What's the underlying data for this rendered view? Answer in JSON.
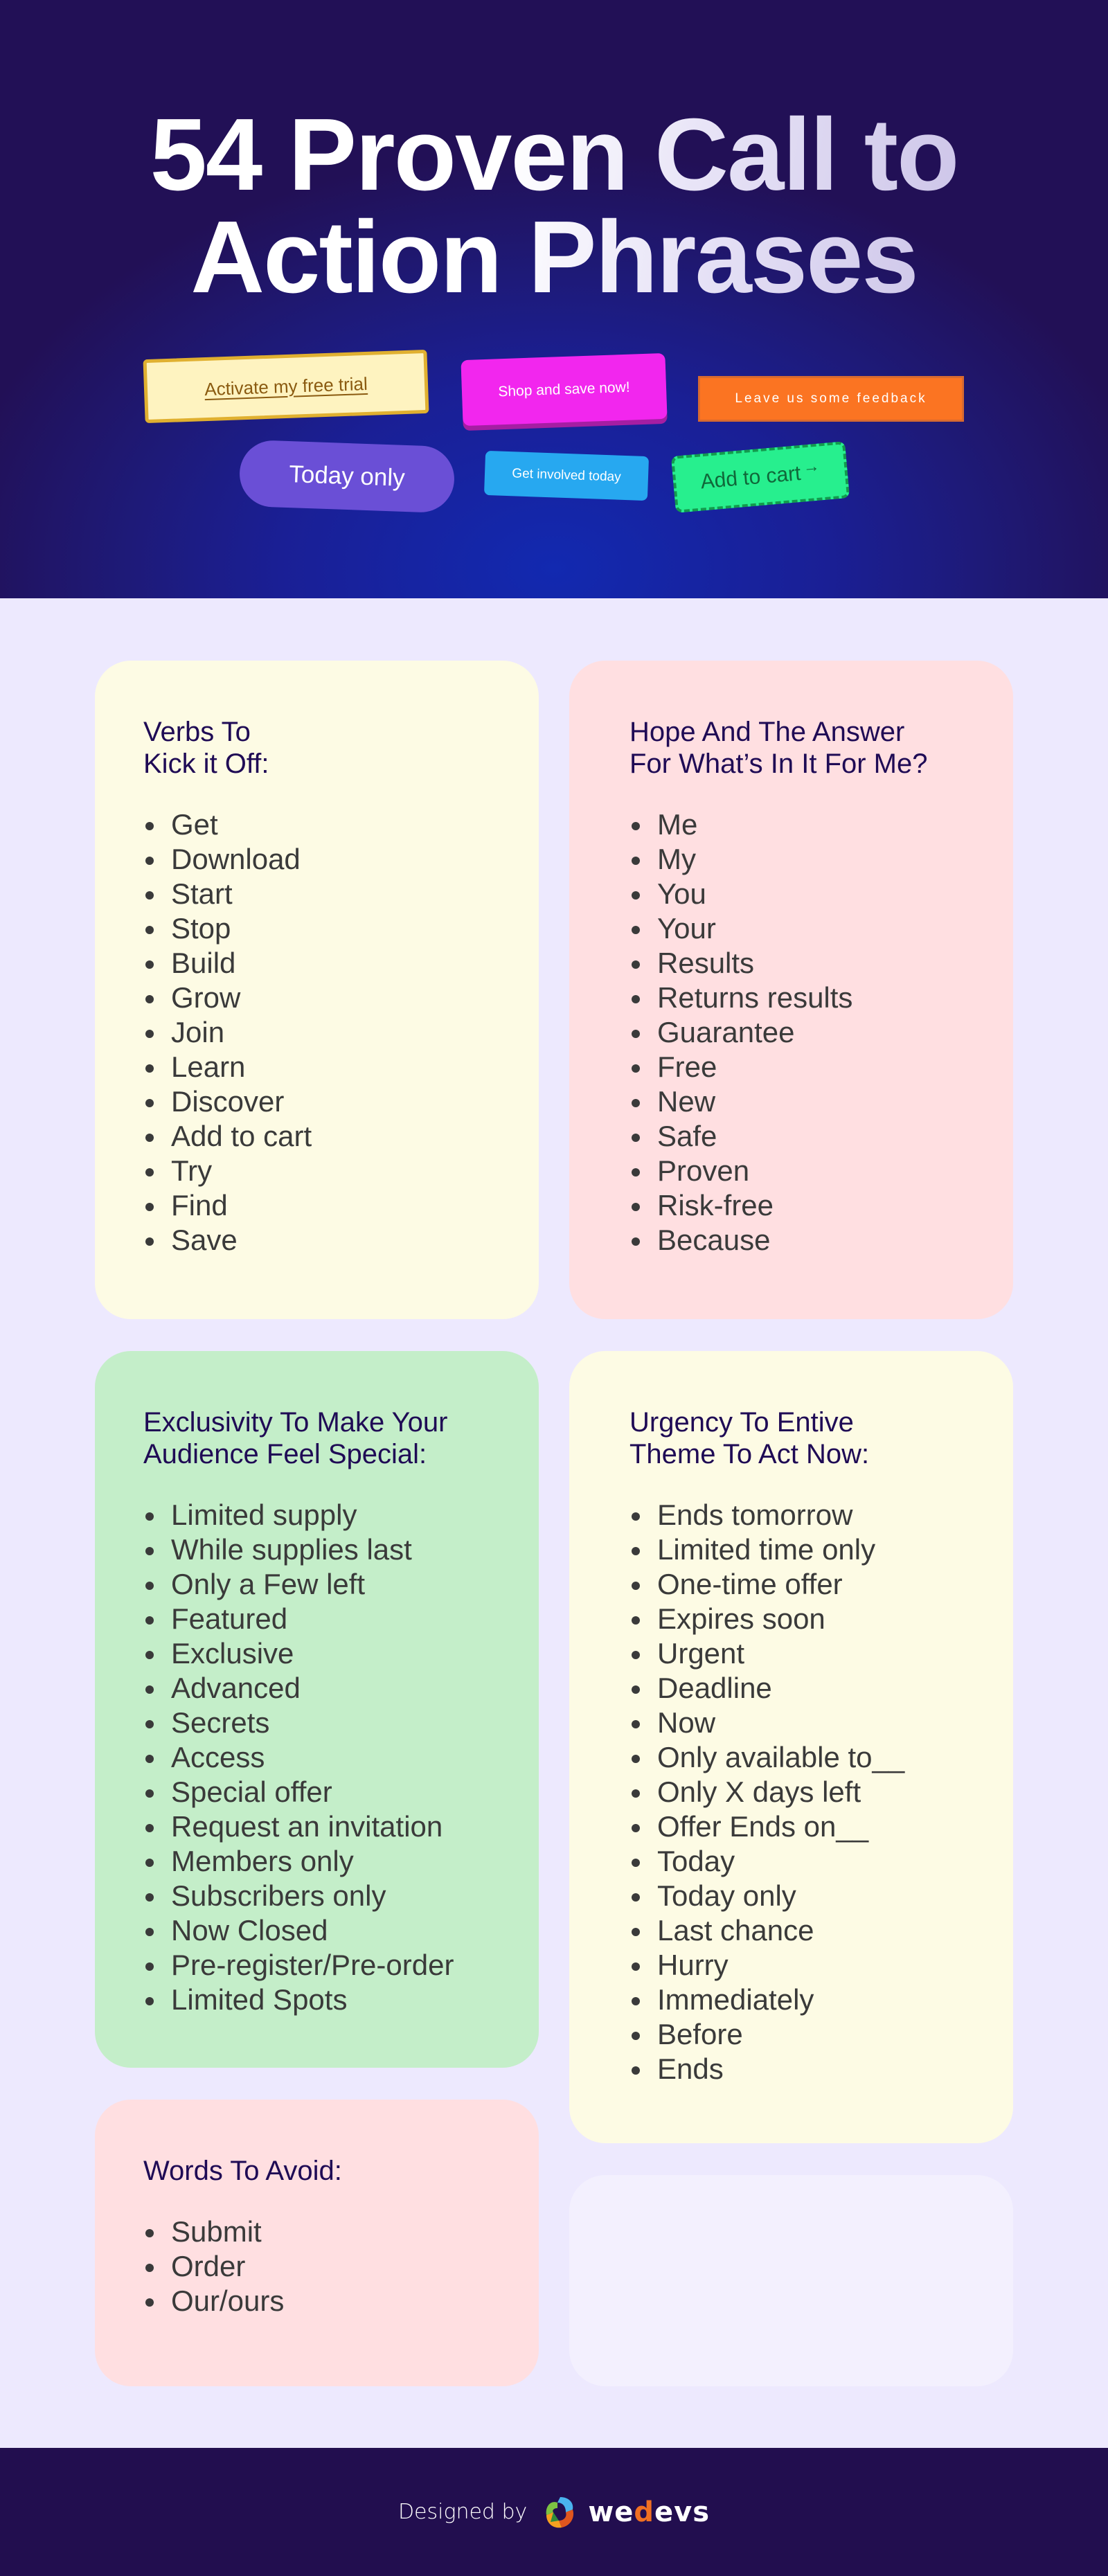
{
  "hero": {
    "title_line1": "54 Proven Call to",
    "title_line2": "Action Phrases",
    "buttons": [
      {
        "label": "Activate my free trial",
        "color": "#fef3c0"
      },
      {
        "label": "Shop and save now!",
        "color": "#f226ee"
      },
      {
        "label": "Leave us some feedback",
        "color": "#fb7422"
      },
      {
        "label": "Today only",
        "color": "#6a4fd6"
      },
      {
        "label": "Get involved today",
        "color": "#27a8f0"
      },
      {
        "label": "Add to cart",
        "icon": "arrow-right-icon",
        "icon_glyph": "→",
        "color": "#27ef8e"
      }
    ]
  },
  "cards": [
    {
      "title": "Verbs To\nKick it Off:",
      "color": "#fdfbe4",
      "items": [
        "Get",
        "Download",
        "Start",
        "Stop",
        "Build",
        "Grow",
        "Join",
        "Learn",
        "Discover",
        "Add to cart",
        "Try",
        "Find",
        "Save"
      ]
    },
    {
      "title": "Hope And The Answer\nFor What’s In It For Me?",
      "color": "#ffdfe1",
      "items": [
        "Me",
        "My",
        "You",
        "Your",
        "Results",
        "Returns results",
        "Guarantee",
        "Free",
        "New",
        "Safe",
        "Proven",
        "Risk-free",
        "Because"
      ]
    },
    {
      "title": "Exclusivity To Make Your\nAudience Feel Special:",
      "color": "#c4eec9",
      "items": [
        "Limited supply",
        "While supplies last",
        "Only a Few left",
        "Featured",
        "Exclusive",
        "Advanced",
        "Secrets",
        "Access",
        "Special offer",
        "Request an invitation",
        "Members only",
        "Subscribers only",
        "Now Closed",
        "Pre-register/Pre-order",
        "Limited Spots"
      ]
    },
    {
      "title": "Urgency To Entive\nTheme To Act Now:",
      "color": "#fdfbe4",
      "items": [
        "Ends tomorrow",
        "Limited time only",
        "One-time offer",
        "Expires soon",
        "Urgent",
        "Deadline",
        "Now",
        "Only available to__",
        "Only X days left",
        "Offer Ends on__",
        "Today",
        "Today only",
        "Last chance",
        "Hurry",
        "Immediately",
        "Before",
        "Ends"
      ]
    },
    {
      "title": "Words To Avoid:",
      "color": "#ffdfe1",
      "items": [
        "Submit",
        "Order",
        "Our/ours"
      ]
    }
  ],
  "footer": {
    "label": "Designed by",
    "brand_part1": "we",
    "brand_accent": "d",
    "brand_part2": "evs",
    "logo_icon": "wedevs-logo-icon",
    "background": "#220e4f"
  }
}
